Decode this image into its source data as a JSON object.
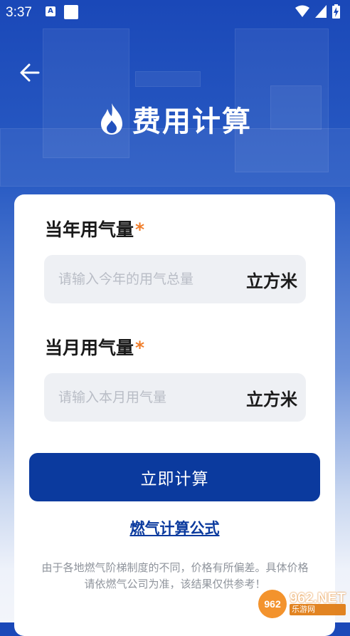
{
  "status_bar": {
    "time": "3:37",
    "notif_icon": "A",
    "icons": [
      "wifi-icon",
      "signal-icon",
      "battery-charging-icon"
    ]
  },
  "header": {
    "back_icon": "arrow-left-icon",
    "title": "费用计算",
    "title_icon": "flame-icon"
  },
  "form": {
    "year_field": {
      "label": "当年用气量",
      "required_mark": "*",
      "placeholder": "请输入今年的用气总量",
      "value": "",
      "unit": "立方米"
    },
    "month_field": {
      "label": "当月用气量",
      "required_mark": "*",
      "placeholder": "请输入本月用气量",
      "value": "",
      "unit": "立方米"
    },
    "calculate_button": "立即计算",
    "formula_link": "燃气计算公式",
    "disclaimer": "由于各地燃气阶梯制度的不同，价格有所偏差。具体价格请依燃气公司为准，该结果仅供参考！"
  },
  "watermark": {
    "logo": "962",
    "main": "962.NET",
    "sub": "乐游网"
  },
  "colors": {
    "primary": "#0b3a9e",
    "header_bg": "#1a48b8",
    "required": "#f07d2a",
    "input_bg": "#eef0f4"
  }
}
